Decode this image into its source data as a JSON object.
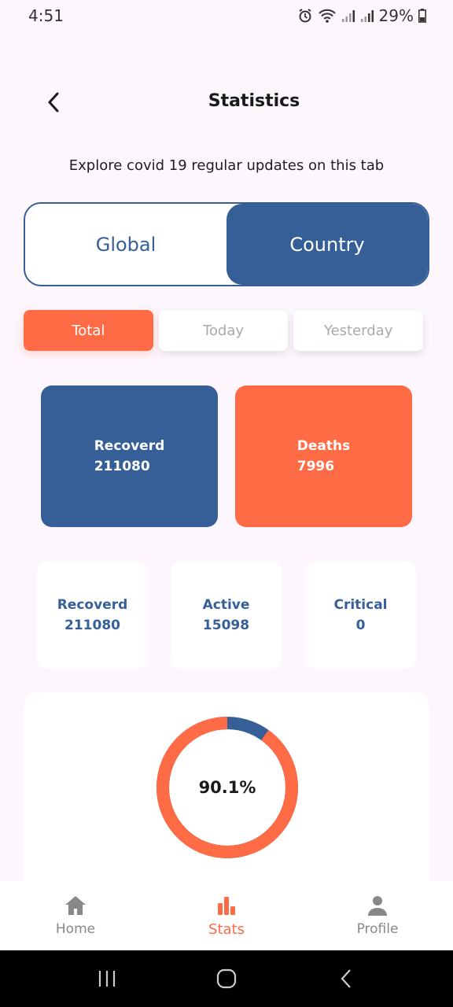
{
  "status_bar": {
    "time": "4:51",
    "battery": "29%"
  },
  "header": {
    "title": "Statistics"
  },
  "subtitle": "Explore covid 19 regular updates on this tab",
  "scope_toggle": {
    "options": [
      "Global",
      "Country"
    ],
    "selected": "Country"
  },
  "period_tabs": {
    "options": [
      "Total",
      "Today",
      "Yesterday"
    ],
    "selected": "Total"
  },
  "big_cards": {
    "recovered": {
      "label": "Recoverd",
      "value": "211080"
    },
    "deaths": {
      "label": "Deaths",
      "value": "7996"
    }
  },
  "small_cards": [
    {
      "label": "Recoverd",
      "value": "211080"
    },
    {
      "label": "Active",
      "value": "15098"
    },
    {
      "label": "Critical",
      "value": "0"
    }
  ],
  "donut": {
    "percent_label": "90.1%",
    "orange_fraction": 0.901,
    "colors": {
      "major": "#ff6b45",
      "minor": "#365f97"
    }
  },
  "bottom_nav": {
    "items": [
      "Home",
      "Stats",
      "Profile"
    ],
    "selected": "Stats"
  },
  "colors": {
    "primary_blue": "#365f97",
    "accent_orange": "#ff6b45",
    "background": "#fdf6fc"
  }
}
